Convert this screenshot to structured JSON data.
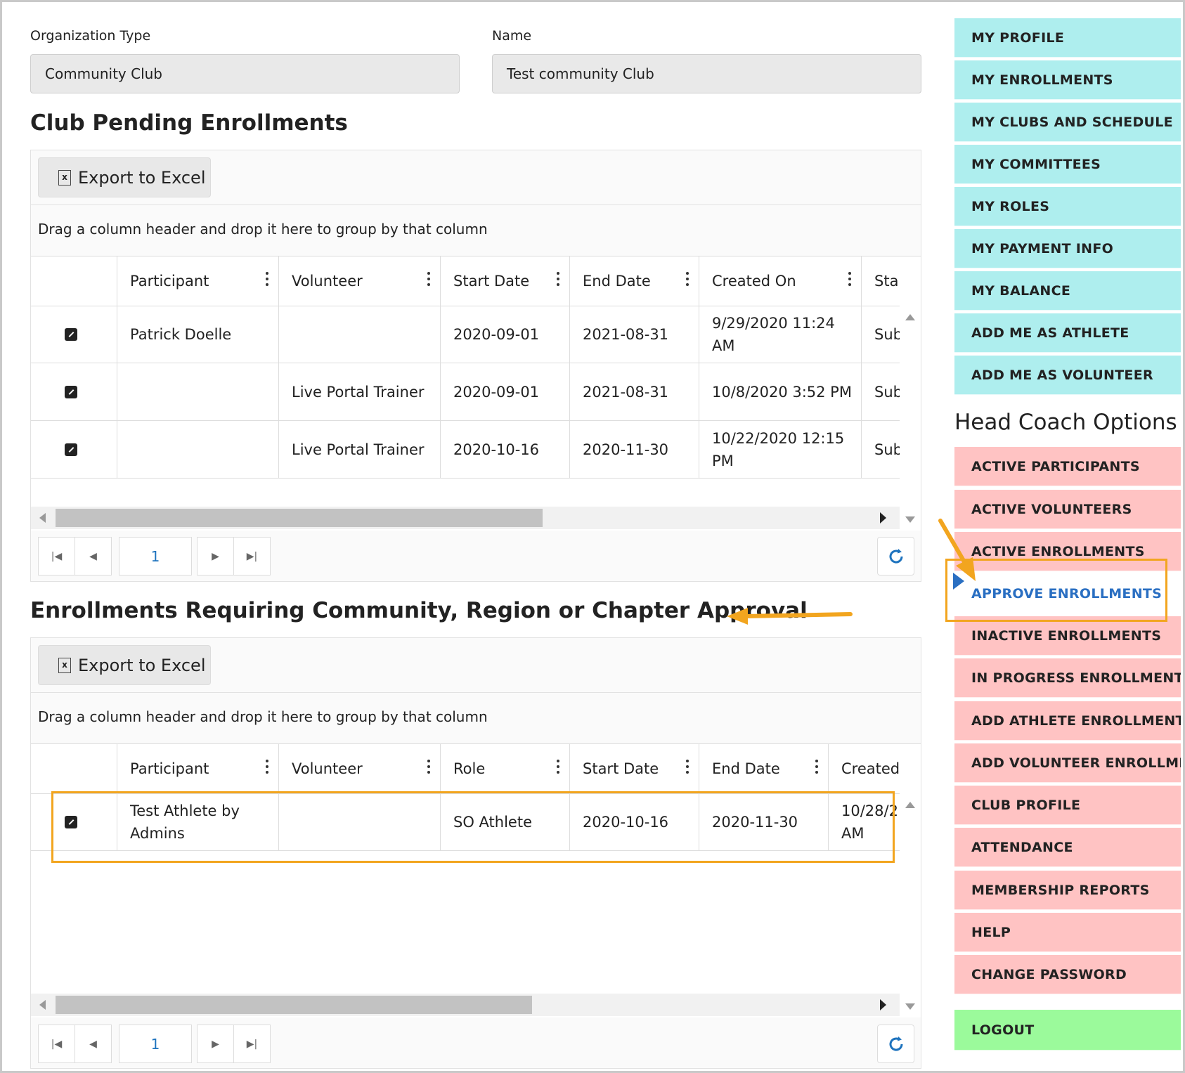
{
  "form": {
    "org_type_label": "Organization Type",
    "org_type_value": "Community Club",
    "name_label": "Name",
    "name_value": "Test community Club"
  },
  "section1": {
    "title": "Club Pending Enrollments",
    "export_label": "Export to Excel",
    "group_hint": "Drag a column header and drop it here to group by that column",
    "columns": [
      "Participant",
      "Volunteer",
      "Start Date",
      "End Date",
      "Created On",
      "Sta"
    ],
    "rows": [
      {
        "participant": "Patrick Doelle",
        "volunteer": "",
        "start": "2020-09-01",
        "end": "2021-08-31",
        "created": "9/29/2020 11:24 AM",
        "status": "Sub"
      },
      {
        "participant": "",
        "volunteer": "Live Portal Trainer",
        "start": "2020-09-01",
        "end": "2021-08-31",
        "created": "10/8/2020 3:52 PM",
        "status": "Sub"
      },
      {
        "participant": "",
        "volunteer": "Live Portal Trainer",
        "start": "2020-10-16",
        "end": "2020-11-30",
        "created": "10/22/2020 12:15 PM",
        "status": "Sub"
      }
    ],
    "page": "1"
  },
  "section2": {
    "title": "Enrollments Requiring Community, Region or Chapter Approval",
    "export_label": "Export to Excel",
    "group_hint": "Drag a column header and drop it here to group by that column",
    "columns": [
      "Participant",
      "Volunteer",
      "Role",
      "Start Date",
      "End Date",
      "Created"
    ],
    "rows": [
      {
        "participant": "Test Athlete by Admins",
        "volunteer": "",
        "role": "SO Athlete",
        "start": "2020-10-16",
        "end": "2020-11-30",
        "created": "10/28/2 AM"
      }
    ],
    "page": "1"
  },
  "sidebar": {
    "profile_items": [
      "MY PROFILE",
      "MY ENROLLMENTS",
      "MY CLUBS AND SCHEDULE",
      "MY COMMITTEES",
      "MY ROLES",
      "MY PAYMENT INFO",
      "MY BALANCE",
      "ADD ME AS ATHLETE",
      "ADD ME AS VOLUNTEER"
    ],
    "coach_heading": "Head Coach Options",
    "coach_items": [
      "ACTIVE PARTICIPANTS",
      "ACTIVE VOLUNTEERS",
      "ACTIVE ENROLLMENTS",
      "APPROVE ENROLLMENTS",
      "INACTIVE ENROLLMENTS",
      "IN PROGRESS ENROLLMENTS",
      "ADD ATHLETE ENROLLMENT",
      "ADD VOLUNTEER ENROLLMENT",
      "CLUB PROFILE",
      "ATTENDANCE",
      "MEMBERSHIP REPORTS",
      "HELP",
      "CHANGE PASSWORD"
    ],
    "active_item": "APPROVE ENROLLMENTS",
    "logout": "LOGOUT"
  },
  "colors": {
    "profile_bg": "#aeeeee",
    "coach_bg": "#ffc3c3",
    "logout_bg": "#9bfa9b",
    "active_text": "#2a6fc2",
    "highlight": "#f2a51f"
  }
}
